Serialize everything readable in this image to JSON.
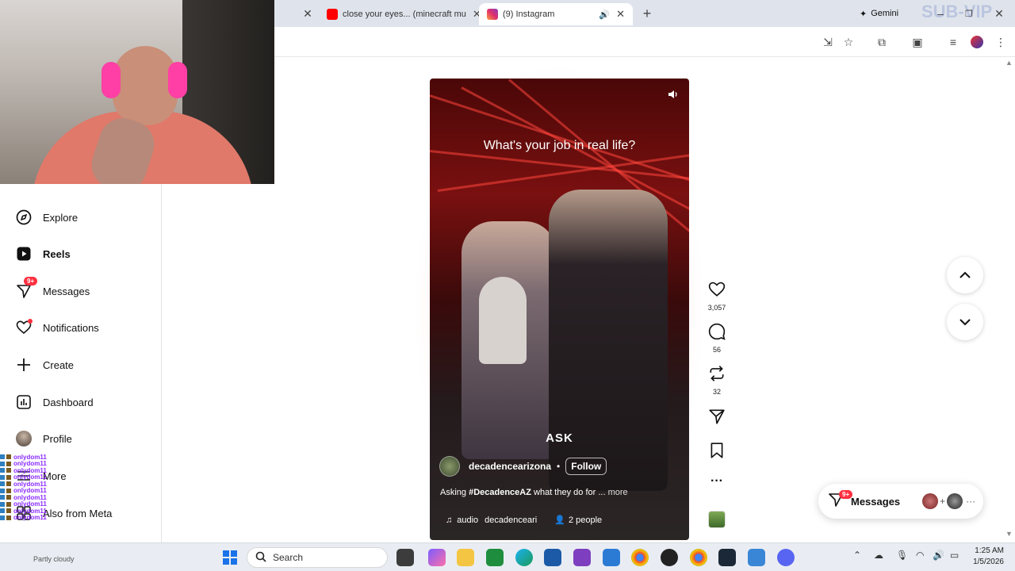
{
  "browser": {
    "tabs": [
      {
        "title": "close your eyes... (minecraft mu",
        "favicon": "youtube-icon",
        "color": "#ff0000"
      },
      {
        "title": "(9) Instagram",
        "favicon": "instagram-icon",
        "color": "#e1306c"
      }
    ],
    "gemini_label": "Gemini",
    "watermark": "SUB-VIP"
  },
  "sidebar": {
    "items": [
      {
        "label": "Explore",
        "icon": "compass-icon"
      },
      {
        "label": "Reels",
        "icon": "reels-icon"
      },
      {
        "label": "Messages",
        "icon": "messenger-icon",
        "badge": "9+"
      },
      {
        "label": "Notifications",
        "icon": "heart-icon"
      },
      {
        "label": "Create",
        "icon": "plus-icon"
      },
      {
        "label": "Dashboard",
        "icon": "dashboard-icon"
      },
      {
        "label": "Profile",
        "icon": "profile-avatar"
      },
      {
        "label": "More",
        "icon": "hamburger-icon"
      },
      {
        "label": "Also from Meta",
        "icon": "grid-icon"
      }
    ]
  },
  "chat": {
    "username": "onlydom11",
    "weather": "Partly cloudy"
  },
  "reel": {
    "question": "What's your job in real life?",
    "overlay_word": "ASK",
    "username": "decadencearizona",
    "follow_label": "Follow",
    "caption_prefix": "Asking ",
    "caption_hashtag": "#DecadenceAZ",
    "caption_rest": " what they do for ... ",
    "caption_more": "more",
    "audio_label": "audio",
    "audio_user": "decadenceari",
    "people": "2 people"
  },
  "actions": {
    "likes": "3,057",
    "comments": "56",
    "reposts": "32"
  },
  "messages_pill": {
    "label": "Messages",
    "badge": "9+"
  },
  "taskbar": {
    "search_placeholder": "Search",
    "time": "1:25 AM",
    "date": "1/5/2026"
  }
}
